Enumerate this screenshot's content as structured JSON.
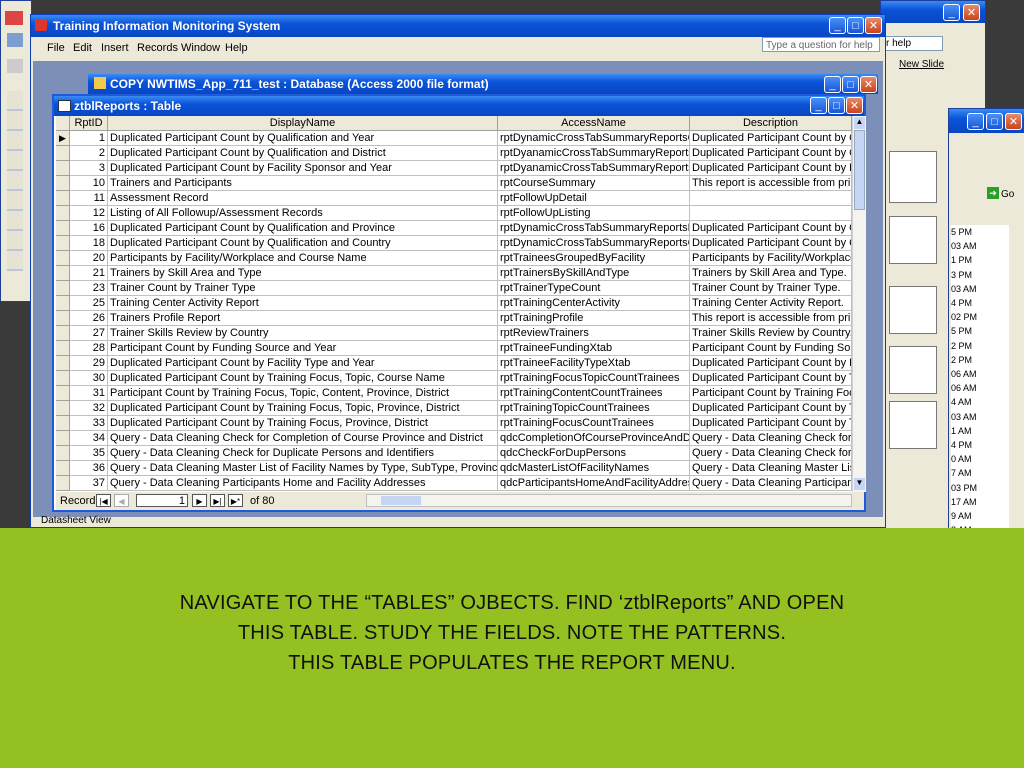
{
  "app": {
    "title": "Training Information Monitoring System",
    "menu": [
      "File",
      "Edit",
      "Insert",
      "Records",
      "Window",
      "Help"
    ],
    "help_placeholder": "Type a question for help",
    "status": "Datasheet View"
  },
  "background": {
    "help_box": "r help",
    "new_slide": "New Slide",
    "go_label": "Go",
    "times": [
      "5 PM",
      "03 AM",
      "1 PM",
      "3 PM",
      "03 AM",
      "4 PM",
      "02 PM",
      "5 PM",
      "2 PM",
      "2 PM",
      "06 AM",
      "06 AM",
      "4 AM",
      "03 AM",
      "1 AM",
      "4 PM",
      "0 AM",
      "7 AM",
      "03 PM",
      "17 AM",
      "9 AM",
      "8 AM"
    ],
    "ts_label": "ts"
  },
  "db_window": {
    "title": "COPY NWTIMS_App_711_test : Database (Access 2000 file format)"
  },
  "table_window": {
    "title": "ztblReports : Table",
    "columns": [
      "RptID",
      "DisplayName",
      "AccessName",
      "Description"
    ],
    "rows": [
      [
        "1",
        "Duplicated Participant Count by Qualification and Year",
        "rptDynamicCrossTabSummaryReportsQu",
        "Duplicated Participant Count by Q"
      ],
      [
        "2",
        "Duplicated Participant Count by Qualification and District",
        "rptDyanamicCrossTabSummaryReportsY",
        "Duplicated Participant Count by Q"
      ],
      [
        "3",
        "Duplicated Participant Count by Facility Sponsor and Year",
        "rptDyanamicCrossTabSummaryReports",
        "Duplicated Participant Count by F"
      ],
      [
        "10",
        "Trainers and Participants",
        "rptCourseSummary",
        "This report is accessible from print"
      ],
      [
        "11",
        "Assessment Record",
        "rptFollowUpDetail",
        ""
      ],
      [
        "12",
        "Listing of All Followup/Assessment Records",
        "rptFollowUpListing",
        ""
      ],
      [
        "16",
        "Duplicated Participant Count by Qualification and Province",
        "rptDynamicCrossTabSummaryReportsPr",
        "Duplicated Participant Count by Q"
      ],
      [
        "18",
        "Duplicated Participant Count by Qualification and Country",
        "rptDynamicCrossTabSummaryReportsCo",
        "Duplicated Participant Count by Q"
      ],
      [
        "20",
        "Participants by Facility/Workplace and Course Name",
        "rptTraineesGroupedByFacility",
        "Participants by Facility/Workplace"
      ],
      [
        "21",
        "Trainers by Skill Area and Type",
        "rptTrainersBySkillAndType",
        "Trainers by Skill Area and Type."
      ],
      [
        "23",
        "Trainer Count by Trainer Type",
        "rptTrainerTypeCount",
        "Trainer Count by Trainer Type."
      ],
      [
        "25",
        "Training Center Activity Report",
        "rptTrainingCenterActivity",
        "Training Center Activity Report."
      ],
      [
        "26",
        "Trainers Profile Report",
        "rptTrainingProfile",
        "This report is accessible from print"
      ],
      [
        "27",
        "Trainer Skills Review by Country",
        "rptReviewTrainers",
        "Trainer Skills Review by Country."
      ],
      [
        "28",
        "Participant Count by Funding Source and Year",
        "rptTraineeFundingXtab",
        "Participant Count by Funding Sour"
      ],
      [
        "29",
        "Duplicated Participant Count by Facility Type and Year",
        "rptTraineeFacilityTypeXtab",
        "Duplicated Participant Count by F"
      ],
      [
        "30",
        "Duplicated Participant Count by Training Focus, Topic, Course Name",
        "rptTrainingFocusTopicCountTrainees",
        "Duplicated Participant Count by Tr"
      ],
      [
        "31",
        "Participant Count by Training Focus, Topic, Content, Province, District",
        "rptTrainingContentCountTrainees",
        "Participant Count by Training Focu"
      ],
      [
        "32",
        "Duplicated Participant Count by Training Focus, Topic, Province, District",
        "rptTrainingTopicCountTrainees",
        "Duplicated Participant Count by Tr"
      ],
      [
        "33",
        "Duplicated Participant Count by Training Focus, Province, District",
        "rptTrainingFocusCountTrainees",
        "Duplicated Participant Count by Tr"
      ],
      [
        "34",
        "Query - Data Cleaning Check for Completion of Course Province and District",
        "qdcCompletionOfCourseProvinceAndDist",
        "Query - Data Cleaning Check for C"
      ],
      [
        "35",
        "Query - Data Cleaning Check for Duplicate Persons and Identifiers",
        "qdcCheckForDupPersons",
        "Query - Data Cleaning Check for D"
      ],
      [
        "36",
        "Query - Data Cleaning Master List of Facility Names by Type, SubType, Province &",
        "qdcMasterListOfFacilityNames",
        "Query - Data Cleaning Master List"
      ],
      [
        "37",
        "Query - Data Cleaning Participants Home and Facility Addresses",
        "qdcParticipantsHomeAndFacilityAddress",
        "Query - Data Cleaning Participants"
      ]
    ],
    "record_label": "Record:",
    "record_current": "1",
    "record_of": "of  80"
  },
  "caption": {
    "line1": "NAVIGATE TO THE “TABLES” OJBECTS. FIND ‘ztblReports” AND OPEN",
    "line2": "THIS TABLE. STUDY THE FIELDS. NOTE THE PATTERNS.",
    "line3": "THIS TABLE POPULATES THE REPORT MENU."
  },
  "colors": {
    "green_panel": "#94c021",
    "title_blue": "#0a53d8",
    "mdi_bg": "#7c8fb8"
  }
}
